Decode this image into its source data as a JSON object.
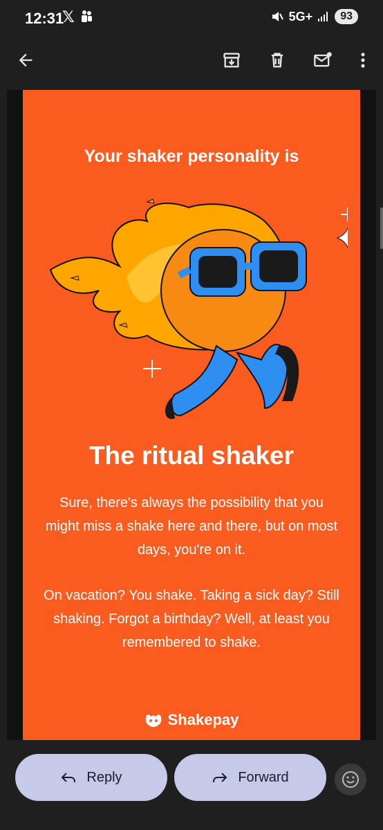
{
  "status": {
    "time": "12:31",
    "x_label": "𝕏",
    "network": "5G+",
    "battery": "93"
  },
  "appbar": {
    "icons": [
      "back-arrow-icon",
      "archive-icon",
      "trash-icon",
      "mark-unread-icon",
      "more-vert-icon"
    ]
  },
  "email": {
    "headline": "Your shaker personality is",
    "title": "The ritual shaker",
    "paragraph1": "Sure, there's always the possibility that you might miss a shake here and there, but on most days, you're on it.",
    "paragraph2": "On vacation? You shake. Taking a sick day? Still shaking. Forgot a birthday? Well, at least you remembered to shake.",
    "brand": "Shakepay",
    "colors": {
      "card": "#fa5b1e",
      "flame": "#ffa500",
      "glasses": "#2f8ff0"
    }
  },
  "actions": {
    "reply_label": "Reply",
    "forward_label": "Forward"
  }
}
